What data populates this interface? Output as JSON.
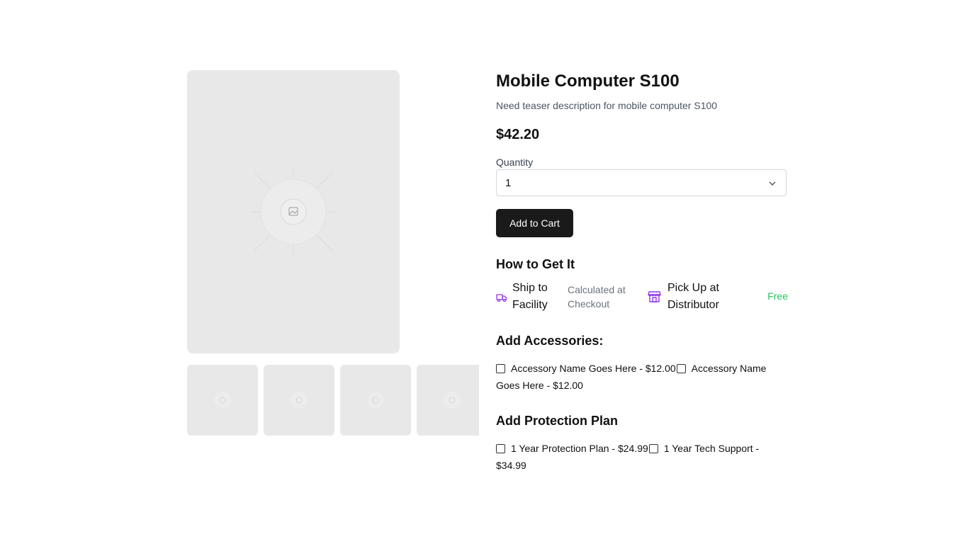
{
  "product": {
    "title": "Mobile Computer S100",
    "teaser": "Need teaser description for mobile computer S100",
    "price": "$42.20"
  },
  "quantity": {
    "label": "Quantity",
    "value": "1"
  },
  "cart": {
    "button_label": "Add to Cart"
  },
  "fulfillment": {
    "heading": "How to Get It",
    "ship": {
      "label": "Ship to Facility",
      "note": "Calculated at Checkout"
    },
    "pickup": {
      "label": "Pick Up at Distributor",
      "note": "Free"
    }
  },
  "accessories": {
    "heading": "Add Accessories:",
    "items": [
      {
        "label": "Accessory Name Goes Here - $12.00"
      },
      {
        "label": "Accessory Name Goes Here - $12.00"
      }
    ]
  },
  "protection": {
    "heading": "Add Protection Plan",
    "items": [
      {
        "label": "1 Year Protection Plan - $24.99"
      },
      {
        "label": "1 Year Tech Support - $34.99"
      }
    ]
  },
  "colors": {
    "ship_icon": "#9333ea",
    "free_text": "#22c55e",
    "button_bg": "#1a1a1a"
  }
}
